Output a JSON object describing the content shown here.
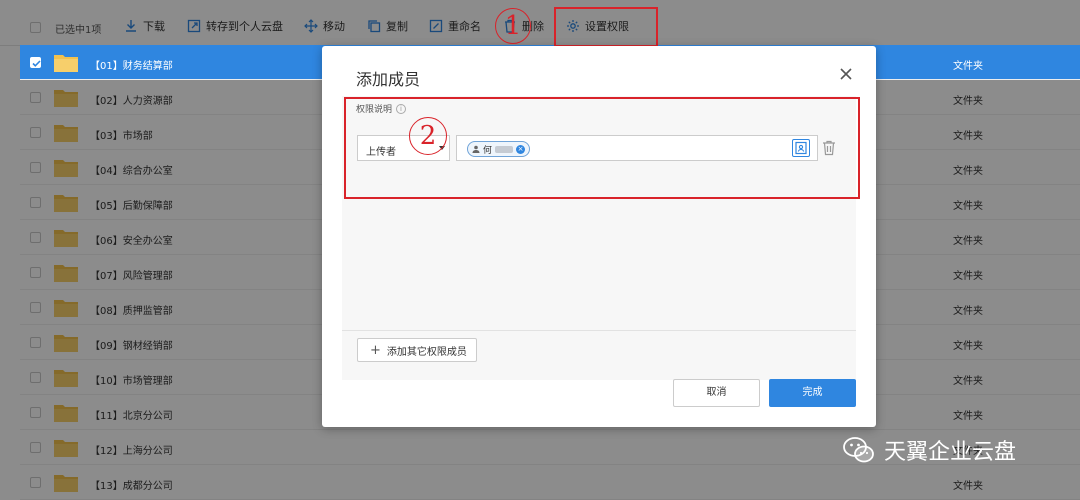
{
  "toolbar": {
    "selected_label": "已选中1项",
    "download": "下载",
    "save_to_personal": "转存到个人云盘",
    "move": "移动",
    "copy": "复制",
    "rename": "重命名",
    "delete": "删除",
    "set_permission": "设置权限"
  },
  "annotations": {
    "one": "1",
    "two": "2"
  },
  "files": [
    {
      "name": "【01】财务结算部",
      "type": "文件夹"
    },
    {
      "name": "【02】人力资源部",
      "type": "文件夹"
    },
    {
      "name": "【03】市场部",
      "type": "文件夹"
    },
    {
      "name": "【04】综合办公室",
      "type": "文件夹"
    },
    {
      "name": "【05】后勤保障部",
      "type": "文件夹"
    },
    {
      "name": "【06】安全办公室",
      "type": "文件夹"
    },
    {
      "name": "【07】风险管理部",
      "type": "文件夹"
    },
    {
      "name": "【08】质押监管部",
      "type": "文件夹"
    },
    {
      "name": "【09】钢材经销部",
      "type": "文件夹"
    },
    {
      "name": "【10】市场管理部",
      "type": "文件夹"
    },
    {
      "name": "【11】北京分公司",
      "type": "文件夹"
    },
    {
      "name": "【12】上海分公司",
      "type": "文件夹"
    },
    {
      "name": "【13】成都分公司",
      "type": "文件夹"
    }
  ],
  "modal": {
    "title": "添加成员",
    "permission_label": "权限说明",
    "role_value": "上传者",
    "member_tag": "何",
    "add_other": "添加其它权限成员",
    "cancel": "取消",
    "done": "完成"
  },
  "watermark": "天翼企业云盘",
  "colors": {
    "accent": "#2f86e0",
    "annotation": "#d9232a",
    "folder": "#f2c14e"
  }
}
